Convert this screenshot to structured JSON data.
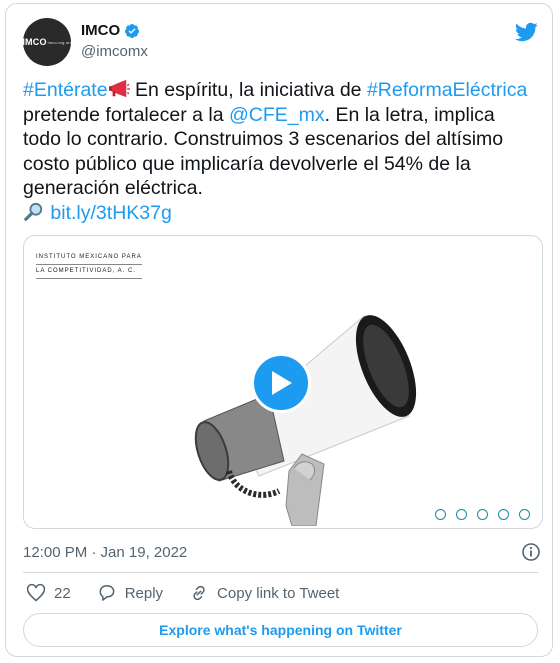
{
  "author": {
    "avatar_text": "IMCO",
    "avatar_subtext": "Centro de Investigación en Política Pública",
    "name": "IMCO",
    "handle": "@imcomx"
  },
  "tweet": {
    "hashtag1": "#Entérate",
    "text1": " En espíritu, la iniciativa de ",
    "hashtag2": "#ReformaEléctrica",
    "text2": " pretende fortalecer a la ",
    "mention": "@CFE_mx",
    "text3": ". En la letra, implica todo lo contrario. Construimos 3 escenarios del altísimo costo público que implicaría devolverle el 54% de la generación eléctrica.",
    "link_text": "bit.ly/3tHK37g"
  },
  "media": {
    "org_line1": "INSTITUTO MEXICANO PARA",
    "org_line2": "LA COMPETITIVIDAD, A. C."
  },
  "meta": {
    "timestamp": "12:00 PM · Jan 19, 2022"
  },
  "actions": {
    "like_count": "22",
    "reply_label": "Reply",
    "copy_label": "Copy link to Tweet"
  },
  "explore_label": "Explore what's happening on Twitter",
  "colors": {
    "accent": "#1d9bf0",
    "text": "#0f1419",
    "secondary": "#536471",
    "border": "#cfd9de"
  }
}
